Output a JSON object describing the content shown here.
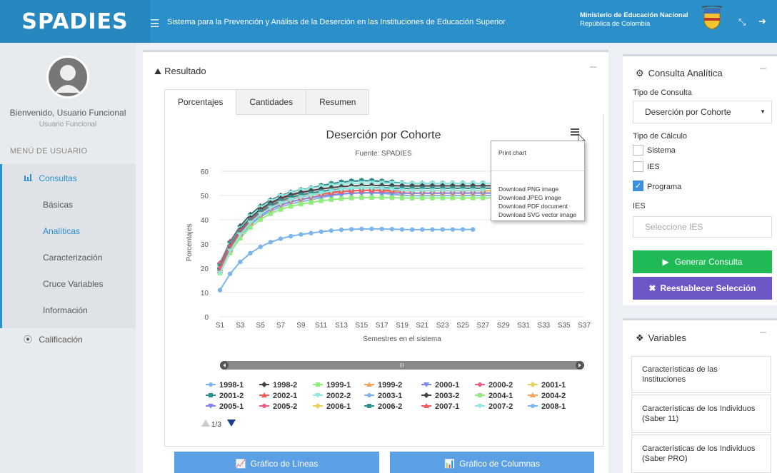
{
  "header": {
    "brand": "SPADIES",
    "menu_icon": "hamburger-icon",
    "system_title": "Sistema para la Prevención y Análisis de la Deserción en las Instituciones de Educación Superior",
    "ministry": "Ministerio de Educación Nacional",
    "country": "República de Colombia",
    "bg_color": "#2b8fc9"
  },
  "sidebar": {
    "welcome": "Bienvenido, Usuario Funcional",
    "role": "Usuario Funcional",
    "menu_header": "MENÚ DE USUARIO",
    "consultas": "Consultas",
    "items": [
      {
        "label": "Básicas"
      },
      {
        "label": "Analíticas"
      },
      {
        "label": "Caracterización"
      },
      {
        "label": "Cruce Variables"
      },
      {
        "label": "Información"
      }
    ],
    "calificacion": "Calificación"
  },
  "result": {
    "title": "Resultado",
    "tabs": [
      "Porcentajes",
      "Cantidades",
      "Resumen"
    ],
    "export_menu": [
      "Print chart",
      "Download PNG image",
      "Download JPEG image",
      "Download PDF document",
      "Download SVG vector image"
    ],
    "legend_page": "1/3",
    "buttons": {
      "lines": "Gráfico de Líneas",
      "columns": "Gráfico de Columnas"
    }
  },
  "chart_data": {
    "type": "line",
    "title": "Deserción por Cohorte",
    "subtitle": "Fuente: SPADIES",
    "xlabel": "Semestres en el sistema",
    "ylabel": "Porcentajes",
    "ylim": [
      0,
      60
    ],
    "yticks": [
      0,
      10,
      20,
      30,
      40,
      50,
      60
    ],
    "x_ticks": [
      "S1",
      "S3",
      "S5",
      "S7",
      "S9",
      "S11",
      "S13",
      "S15",
      "S17",
      "S19",
      "S21",
      "S23",
      "S25",
      "S27",
      "S29",
      "S31",
      "S33",
      "S35",
      "S37"
    ],
    "grid": true,
    "legend_position": "bottom",
    "series": [
      {
        "name": "1998-1",
        "color": "#7cb5ec",
        "symbol": "circle",
        "start": 22,
        "plateau": 53
      },
      {
        "name": "1998-2",
        "color": "#434348",
        "symbol": "diamond",
        "start": 22,
        "plateau": 55
      },
      {
        "name": "1999-1",
        "color": "#90ed7d",
        "symbol": "square",
        "start": 21,
        "plateau": 54
      },
      {
        "name": "1999-2",
        "color": "#f7a35c",
        "symbol": "triangle",
        "start": 21,
        "plateau": 53
      },
      {
        "name": "2000-1",
        "color": "#8085e9",
        "symbol": "triangle-down",
        "start": 20,
        "plateau": 52
      },
      {
        "name": "2000-2",
        "color": "#f15c80",
        "symbol": "circle",
        "start": 22,
        "plateau": 54
      },
      {
        "name": "2001-1",
        "color": "#e4d354",
        "symbol": "diamond",
        "start": 21,
        "plateau": 53
      },
      {
        "name": "2001-2",
        "color": "#2b908f",
        "symbol": "square",
        "start": 21,
        "plateau": 55
      },
      {
        "name": "2002-1",
        "color": "#f45b5b",
        "symbol": "triangle",
        "start": 20,
        "plateau": 52
      },
      {
        "name": "2002-2",
        "color": "#91e8e1",
        "symbol": "triangle-down",
        "start": 20,
        "plateau": 55
      },
      {
        "name": "2003-1",
        "color": "#7cb5ec",
        "symbol": "circle",
        "start": 19,
        "plateau": 50
      },
      {
        "name": "2003-2",
        "color": "#434348",
        "symbol": "diamond",
        "start": 20,
        "plateau": 54
      },
      {
        "name": "2004-1",
        "color": "#90ed7d",
        "symbol": "square",
        "start": 18,
        "plateau": 49
      },
      {
        "name": "2004-2",
        "color": "#f7a35c",
        "symbol": "triangle",
        "start": 19,
        "plateau": 51
      },
      {
        "name": "2005-1",
        "color": "#8085e9",
        "symbol": "triangle-down",
        "start": 19,
        "plateau": 51
      },
      {
        "name": "2005-2",
        "color": "#f15c80",
        "symbol": "circle",
        "start": 20,
        "plateau": 53
      },
      {
        "name": "2006-1",
        "color": "#e4d354",
        "symbol": "diamond",
        "start": 19,
        "plateau": 52
      },
      {
        "name": "2006-2",
        "color": "#2b908f",
        "symbol": "square",
        "start": 19,
        "plateau": 53
      },
      {
        "name": "2007-1",
        "color": "#f45b5b",
        "symbol": "triangle",
        "start": 19,
        "plateau": 52
      },
      {
        "name": "2007-2",
        "color": "#91e8e1",
        "symbol": "triangle-down",
        "start": 18,
        "plateau": 52
      },
      {
        "name": "2008-1",
        "color": "#7cb5ec",
        "symbol": "circle",
        "start": 11,
        "plateau": 36
      }
    ]
  },
  "consulta": {
    "title": "Consulta Analítica",
    "tipo_consulta_label": "Tipo de Consulta",
    "tipo_consulta_value": "Deserción por Cohorte",
    "tipo_calculo_label": "Tipo de Cálculo",
    "options": [
      {
        "label": "Sistema",
        "checked": false
      },
      {
        "label": "IES",
        "checked": false
      },
      {
        "label": "Programa",
        "checked": true
      }
    ],
    "ies_label": "IES",
    "ies_placeholder": "Seleccione IES",
    "generate": "Generar Consulta",
    "reset": "Reestablecer Selección"
  },
  "variables": {
    "title": "Variables",
    "items": [
      "Características de las Instituciones",
      "Características de los Individuos (Saber 11)",
      "Características de los Individuos (Saber PRO)"
    ]
  }
}
